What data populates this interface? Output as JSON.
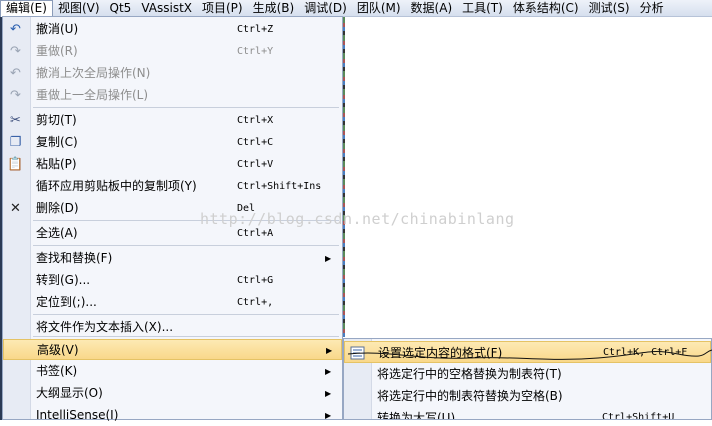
{
  "menubar": [
    "编辑(E)",
    "视图(V)",
    "Qt5",
    "VAssistX",
    "项目(P)",
    "生成(B)",
    "调试(D)",
    "团队(M)",
    "数据(A)",
    "工具(T)",
    "体系结构(C)",
    "测试(S)",
    "分析"
  ],
  "menu": [
    {
      "label": "撤消(U)",
      "shortcut": "Ctrl+Z",
      "icon": "undo-icon",
      "glyph": "↶",
      "color": "#2a5fb0",
      "disabled": false
    },
    {
      "label": "重做(R)",
      "shortcut": "Ctrl+Y",
      "icon": "redo-icon",
      "glyph": "↷",
      "color": "#9aa4b4",
      "disabled": true
    },
    {
      "label": "撤消上次全局操作(N)",
      "shortcut": "",
      "icon": "undo-global-icon",
      "glyph": "↶",
      "color": "#9aa4b4",
      "disabled": true
    },
    {
      "label": "重做上一全局操作(L)",
      "shortcut": "",
      "icon": "redo-global-icon",
      "glyph": "↷",
      "color": "#9aa4b4",
      "disabled": true
    },
    {
      "label": "剪切(T)",
      "shortcut": "Ctrl+X",
      "icon": "scissors-icon",
      "glyph": "✂",
      "color": "#3a4c7a",
      "disabled": false
    },
    {
      "label": "复制(C)",
      "shortcut": "Ctrl+C",
      "icon": "copy-icon",
      "glyph": "❐",
      "color": "#3a63a8",
      "disabled": false
    },
    {
      "label": "粘贴(P)",
      "shortcut": "Ctrl+V",
      "icon": "paste-icon",
      "glyph": "📋",
      "color": "#b58a2a",
      "disabled": false
    },
    {
      "label": "循环应用剪贴板中的复制项(Y)",
      "shortcut": "Ctrl+Shift+Ins",
      "icon": "",
      "glyph": "",
      "color": "",
      "disabled": false
    },
    {
      "label": "删除(D)",
      "shortcut": "Del",
      "icon": "delete-icon",
      "glyph": "✕",
      "color": "#222",
      "disabled": false
    },
    {
      "label": "全选(A)",
      "shortcut": "Ctrl+A",
      "icon": "",
      "glyph": "",
      "color": "",
      "disabled": false
    },
    {
      "label": "查找和替换(F)",
      "shortcut": "",
      "icon": "",
      "glyph": "",
      "color": "",
      "disabled": false,
      "submenu": true
    },
    {
      "label": "转到(G)...",
      "shortcut": "Ctrl+G",
      "icon": "",
      "glyph": "",
      "color": "",
      "disabled": false
    },
    {
      "label": "定位到(;)...",
      "shortcut": "Ctrl+,",
      "icon": "",
      "glyph": "",
      "color": "",
      "disabled": false
    },
    {
      "label": "将文件作为文本插入(X)...",
      "shortcut": "",
      "icon": "",
      "glyph": "",
      "color": "",
      "disabled": false
    },
    {
      "label": "高级(V)",
      "shortcut": "",
      "icon": "",
      "glyph": "",
      "color": "",
      "disabled": false,
      "submenu": true,
      "highlighted": true
    },
    {
      "label": "书签(K)",
      "shortcut": "",
      "icon": "",
      "glyph": "",
      "color": "",
      "disabled": false,
      "submenu": true
    },
    {
      "label": "大纲显示(O)",
      "shortcut": "",
      "icon": "",
      "glyph": "",
      "color": "",
      "disabled": false,
      "submenu": true
    },
    {
      "label": "IntelliSense(I)",
      "shortcut": "",
      "icon": "",
      "glyph": "",
      "color": "",
      "disabled": false,
      "submenu": true
    }
  ],
  "submenu": [
    {
      "label": "设置选定内容的格式(F)",
      "shortcut": "Ctrl+K, Ctrl+F",
      "icon": "format-icon",
      "highlighted": true
    },
    {
      "label": "将选定行中的空格替换为制表符(T)",
      "shortcut": "",
      "icon": ""
    },
    {
      "label": "将选定行中的制表符替换为空格(B)",
      "shortcut": "",
      "icon": ""
    },
    {
      "label": "转换为大写(U)",
      "shortcut": "Ctrl+Shift+U",
      "icon": ""
    }
  ],
  "watermark": "http://blog.csdn.net/chinabinlang",
  "colors": {
    "highlight": "#fbe2a0",
    "menu_bg": "#f4f6fb",
    "gutter": "#e7ebf4",
    "menubar": "#d6dfee"
  }
}
